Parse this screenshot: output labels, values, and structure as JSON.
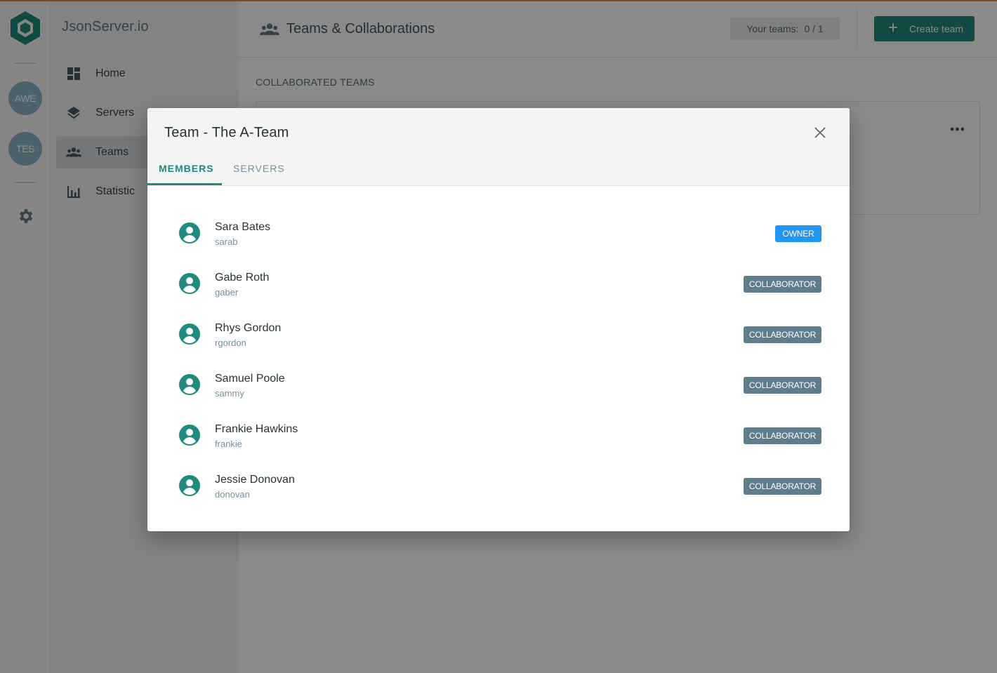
{
  "app": {
    "name": "JsonServer.io",
    "accent_color": "#1f8a7d"
  },
  "rail": {
    "avatars": [
      "AWE",
      "TES"
    ]
  },
  "sidebar": {
    "items": [
      {
        "label": "Home",
        "icon": "dashboard-icon"
      },
      {
        "label": "Servers",
        "icon": "layers-icon"
      },
      {
        "label": "Teams",
        "icon": "people-icon",
        "active": true
      },
      {
        "label": "Statistic",
        "icon": "bar-chart-icon"
      }
    ]
  },
  "header": {
    "title": "Teams & Collaborations",
    "teams_count_label": "Your teams:",
    "teams_count_value": "0 / 1",
    "create_label": "Create team"
  },
  "main": {
    "section_title": "COLLABORATED TEAMS"
  },
  "modal": {
    "title": "Team - The A-Team",
    "tabs": [
      {
        "label": "MEMBERS",
        "active": true
      },
      {
        "label": "SERVERS",
        "active": false
      }
    ],
    "members": [
      {
        "name": "Sara Bates",
        "username": "sarab",
        "role": "OWNER"
      },
      {
        "name": "Gabe Roth",
        "username": "gaber",
        "role": "COLLABORATOR"
      },
      {
        "name": "Rhys Gordon",
        "username": "rgordon",
        "role": "COLLABORATOR"
      },
      {
        "name": "Samuel Poole",
        "username": "sammy",
        "role": "COLLABORATOR"
      },
      {
        "name": "Frankie Hawkins",
        "username": "frankie",
        "role": "COLLABORATOR"
      },
      {
        "name": "Jessie Donovan",
        "username": "donovan",
        "role": "COLLABORATOR"
      }
    ],
    "role_colors": {
      "OWNER": "#2196f3",
      "COLLABORATOR": "#5f7d8c"
    }
  }
}
